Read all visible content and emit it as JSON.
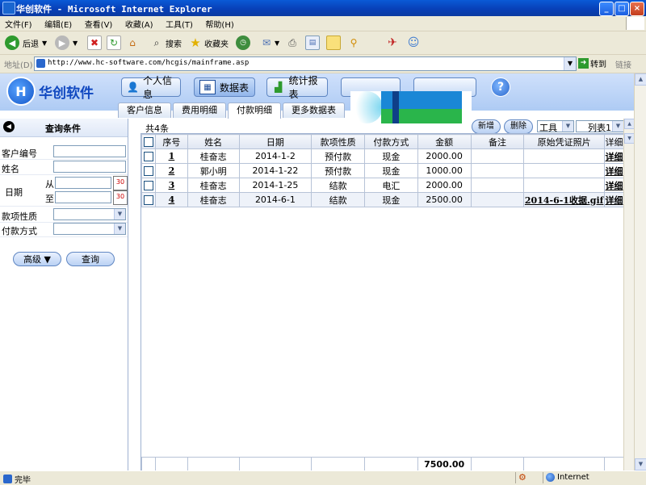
{
  "window": {
    "title": "华创软件 - Microsoft Internet Explorer",
    "controls": {
      "minimize": "_",
      "maximize": "□",
      "close": "×"
    }
  },
  "menu": [
    "文件(F)",
    "编辑(E)",
    "查看(V)",
    "收藏(A)",
    "工具(T)",
    "帮助(H)"
  ],
  "toolbar": {
    "back": "后退",
    "search": "搜索",
    "favorites": "收藏夹"
  },
  "address": {
    "label": "地址(D)",
    "url": "http://www.hc-software.com/hcgis/mainframe.asp",
    "go": "转到",
    "links": "链接"
  },
  "banner": {
    "logo_text": "华创软件",
    "nav": [
      "个人信息",
      "数据表",
      "统计报表"
    ],
    "active_nav": "数据表",
    "help": "?"
  },
  "tabs": [
    "客户信息",
    "费用明细",
    "付款明细",
    "更多数据表"
  ],
  "active_tab": "付款明细",
  "query": {
    "title": "查询条件",
    "fields": {
      "customer_no": "客户编号",
      "name": "姓名",
      "date": "日期",
      "from": "从",
      "to": "至",
      "payment_type": "款项性质",
      "payment_method": "付款方式"
    },
    "advanced_button": "高级 ▼",
    "search_button": "查询"
  },
  "grid": {
    "count": "共4条",
    "add_button": "新增",
    "delete_button": "删除",
    "tools_select": "工具",
    "view_select": "列表1",
    "columns": [
      "序号",
      "姓名",
      "日期",
      "款项性质",
      "付款方式",
      "金额",
      "备注",
      "原始凭证照片",
      "详细"
    ],
    "rows": [
      {
        "no": "1",
        "name": "桂奋志",
        "date": "2014-1-2",
        "type": "预付款",
        "method": "现金",
        "amount": "2000.00",
        "note": "",
        "photo": "",
        "detail": "详细"
      },
      {
        "no": "2",
        "name": "郭小明",
        "date": "2014-1-22",
        "type": "预付款",
        "method": "现金",
        "amount": "1000.00",
        "note": "",
        "photo": "",
        "detail": "详细"
      },
      {
        "no": "3",
        "name": "桂奋志",
        "date": "2014-1-25",
        "type": "结款",
        "method": "电汇",
        "amount": "2000.00",
        "note": "",
        "photo": "",
        "detail": "详细"
      },
      {
        "no": "4",
        "name": "桂奋志",
        "date": "2014-6-1",
        "type": "结款",
        "method": "现金",
        "amount": "2500.00",
        "note": "",
        "photo": "2014-6-1收据.gif",
        "detail": "详细"
      }
    ],
    "total": "7500.00"
  },
  "status": {
    "text": "完毕",
    "zone": "Internet"
  },
  "colors": {
    "titlebar": "#0a5ad6",
    "banner": "#cfe0fb",
    "logo_text": "#1048c0"
  }
}
